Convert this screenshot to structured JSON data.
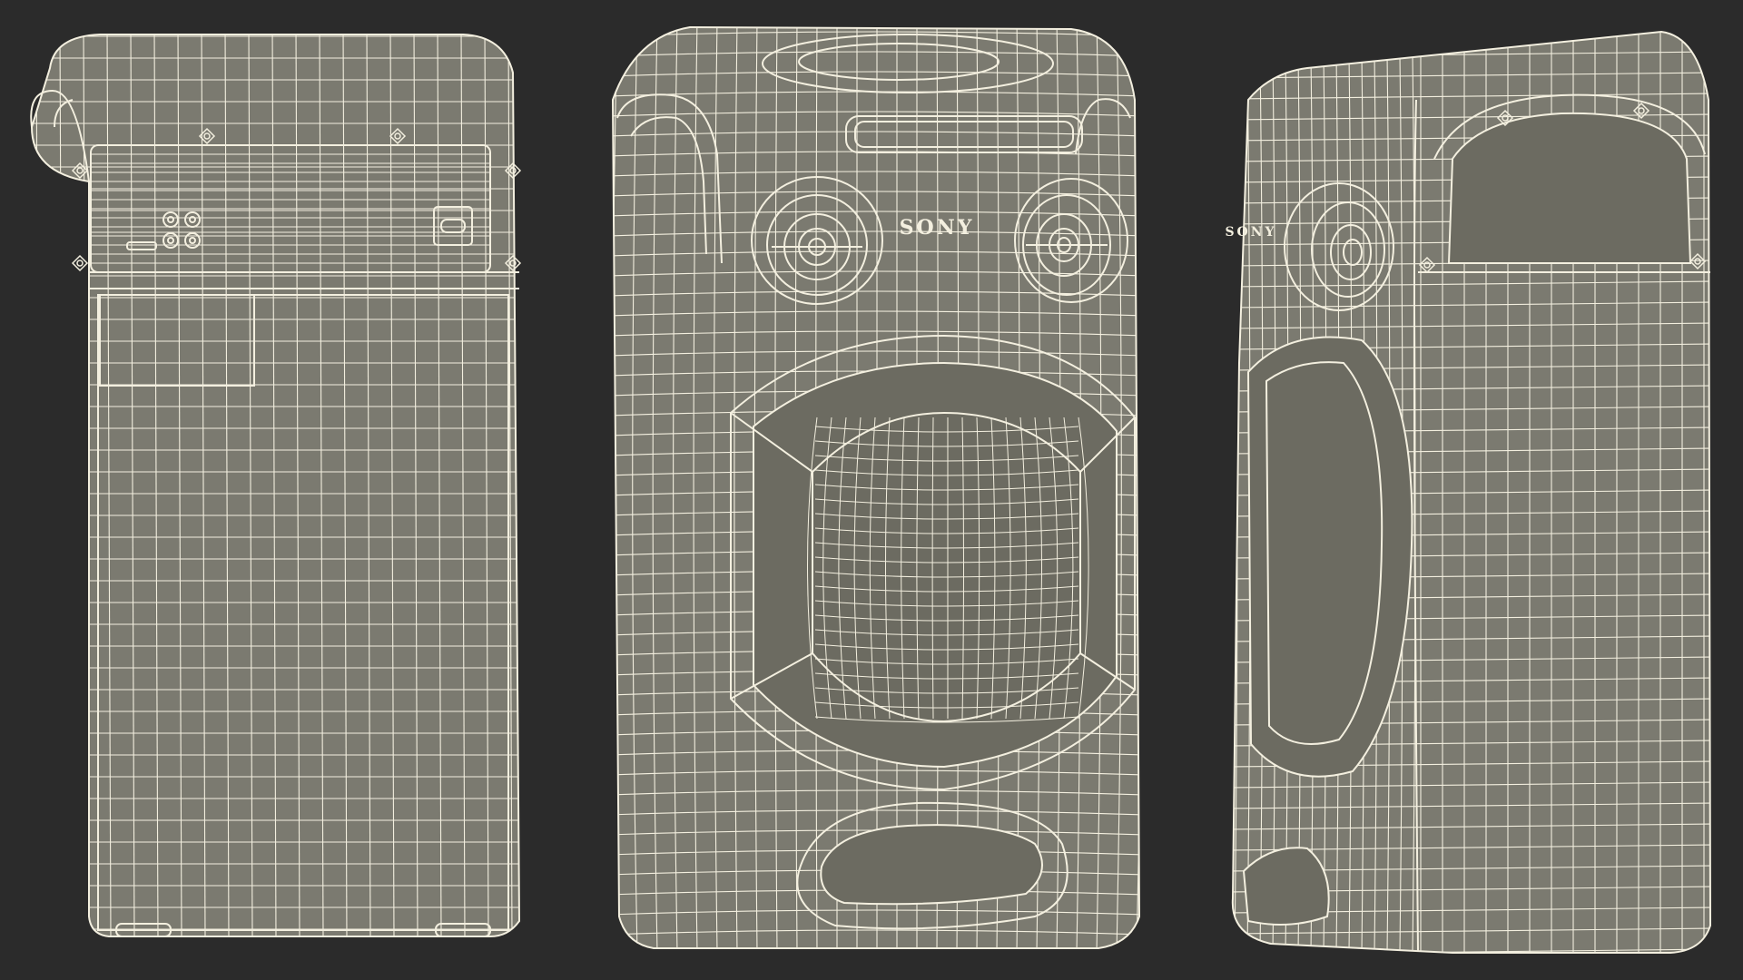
{
  "scene": {
    "background_color": "#2b2b2b",
    "body_color": "#7b7a70",
    "body_shade_color": "#6c6b61",
    "wire_color": "#f3efdf",
    "views": [
      {
        "name": "back-view"
      },
      {
        "name": "front-view"
      },
      {
        "name": "side-view"
      }
    ]
  },
  "logos": {
    "front": "SONY",
    "side": "SONY"
  }
}
